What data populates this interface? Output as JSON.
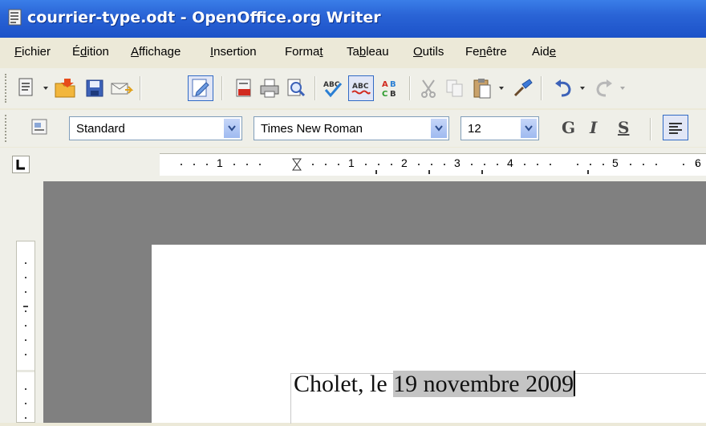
{
  "window": {
    "title": "courrier-type.odt - OpenOffice.org Writer"
  },
  "menu": {
    "items": [
      {
        "pre": "",
        "u": "F",
        "post": "ichier"
      },
      {
        "pre": "É",
        "u": "d",
        "post": "ition"
      },
      {
        "pre": "",
        "u": "A",
        "post": "ffichage"
      },
      {
        "pre": "",
        "u": "I",
        "post": "nsertion"
      },
      {
        "pre": "Forma",
        "u": "t",
        "post": ""
      },
      {
        "pre": "Ta",
        "u": "b",
        "post": "leau"
      },
      {
        "pre": "",
        "u": "O",
        "post": "utils"
      },
      {
        "pre": "Fe",
        "u": "n",
        "post": "être"
      },
      {
        "pre": "Aid",
        "u": "e",
        "post": ""
      }
    ]
  },
  "formatting": {
    "style_value": "Standard",
    "font_value": "Times New Roman",
    "size_value": "12",
    "bold_label": "G",
    "italic_label": "I",
    "underline_label": "S"
  },
  "ruler": {
    "numbers": [
      "1",
      "1",
      "2",
      "3",
      "4",
      "5",
      "6"
    ]
  },
  "document": {
    "text_before": "Cholet, le ",
    "text_selected": "19 novembre 2009"
  },
  "colors": {
    "titlebar": "#2a64d6",
    "selection": "#c4c4c4",
    "workspace": "#808080"
  },
  "icons": [
    "document-icon",
    "new-icon",
    "open-icon",
    "save-icon",
    "email-icon",
    "edit-mode-icon",
    "pdf-icon",
    "print-icon",
    "print-preview-icon",
    "spellcheck-icon",
    "autospell-icon",
    "autocorrect-icon",
    "cut-icon",
    "copy-icon",
    "paste-icon",
    "clone-format-icon",
    "undo-icon",
    "redo-icon",
    "styles-icon",
    "align-left-icon"
  ]
}
